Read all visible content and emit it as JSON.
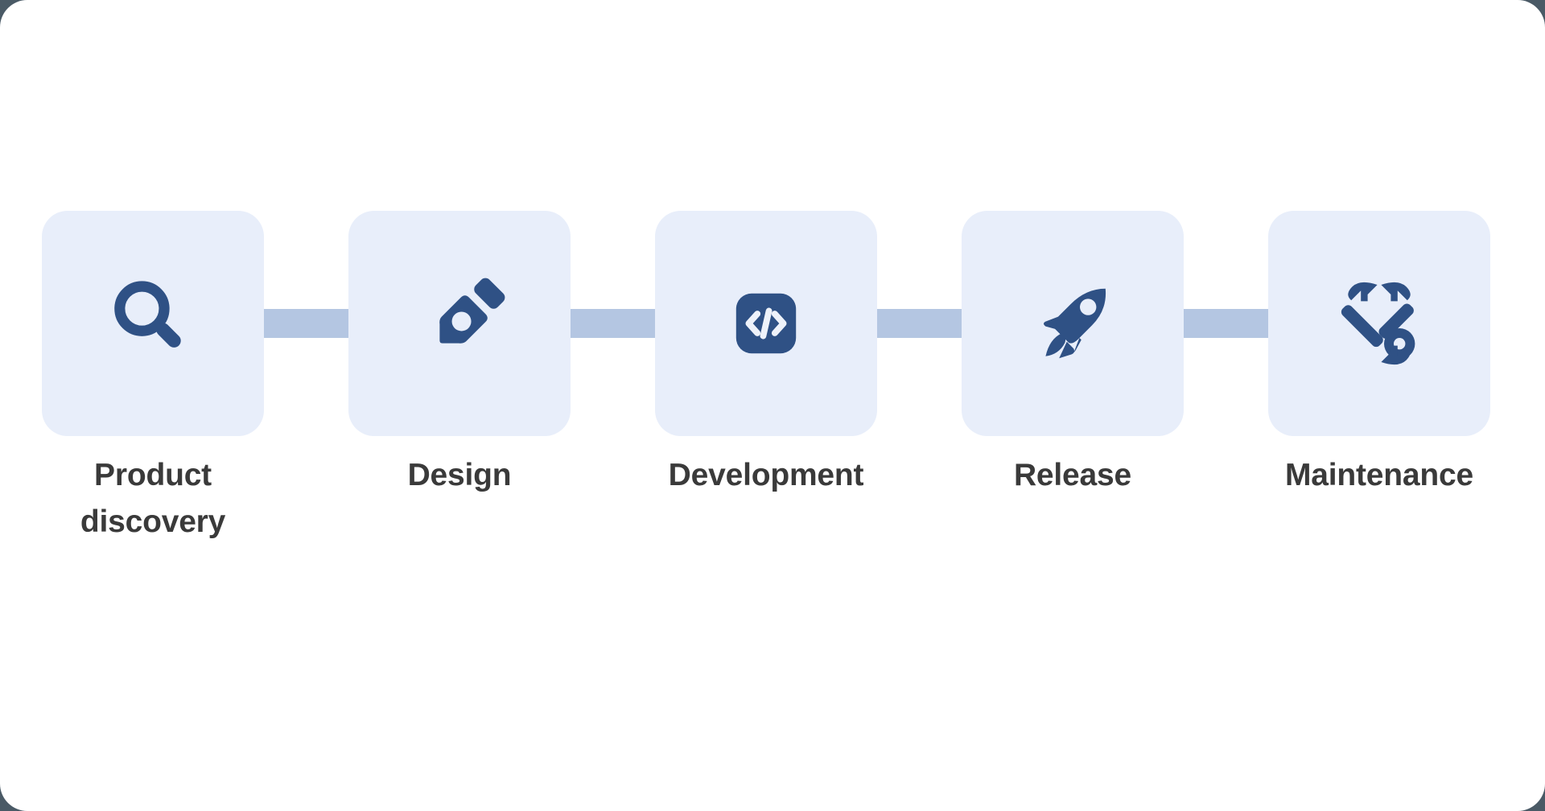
{
  "diagram": {
    "type": "process-flow",
    "orientation": "horizontal",
    "title": "",
    "colors": {
      "page_background": "#ffffff",
      "backdrop": "#4a5a66",
      "card_background": "#e8eefa",
      "icon_color": "#2f5185",
      "connector_color": "#b4c6e2",
      "label_color": "#3a3a3a"
    },
    "steps": [
      {
        "index": 1,
        "label": "Product\ndiscovery",
        "icon": "magnifier-icon"
      },
      {
        "index": 2,
        "label": "Design",
        "icon": "pen-nib-icon"
      },
      {
        "index": 3,
        "label": "Development",
        "icon": "code-brackets-icon"
      },
      {
        "index": 4,
        "label": "Release",
        "icon": "rocket-icon"
      },
      {
        "index": 5,
        "label": "Maintenance",
        "icon": "crossed-wrenches-icon"
      }
    ],
    "connectors": [
      {
        "from": "Product discovery",
        "to": "Design"
      },
      {
        "from": "Design",
        "to": "Development"
      },
      {
        "from": "Development",
        "to": "Release"
      },
      {
        "from": "Release",
        "to": "Maintenance"
      }
    ]
  }
}
